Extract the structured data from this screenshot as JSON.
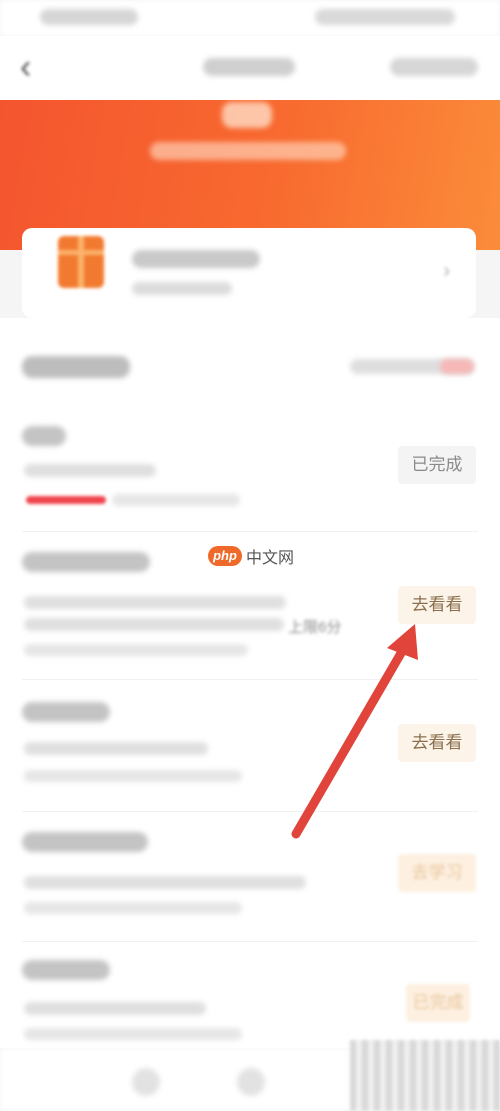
{
  "nav": {
    "back_icon": "back-icon"
  },
  "tasks": [
    {
      "button_label": "已完成"
    },
    {
      "button_label": "去看看",
      "inline_text": "上限6分"
    },
    {
      "button_label": "去看看"
    },
    {
      "button_label": "去学习"
    },
    {
      "button_label": "已完成"
    }
  ],
  "watermark": {
    "logo": "php",
    "text": "中文网"
  },
  "annotation": {
    "arrow_color": "#e0443a"
  },
  "colors": {
    "banner_start": "#f4552f",
    "banner_end": "#fb8c3a",
    "progress": "#f0434b"
  }
}
